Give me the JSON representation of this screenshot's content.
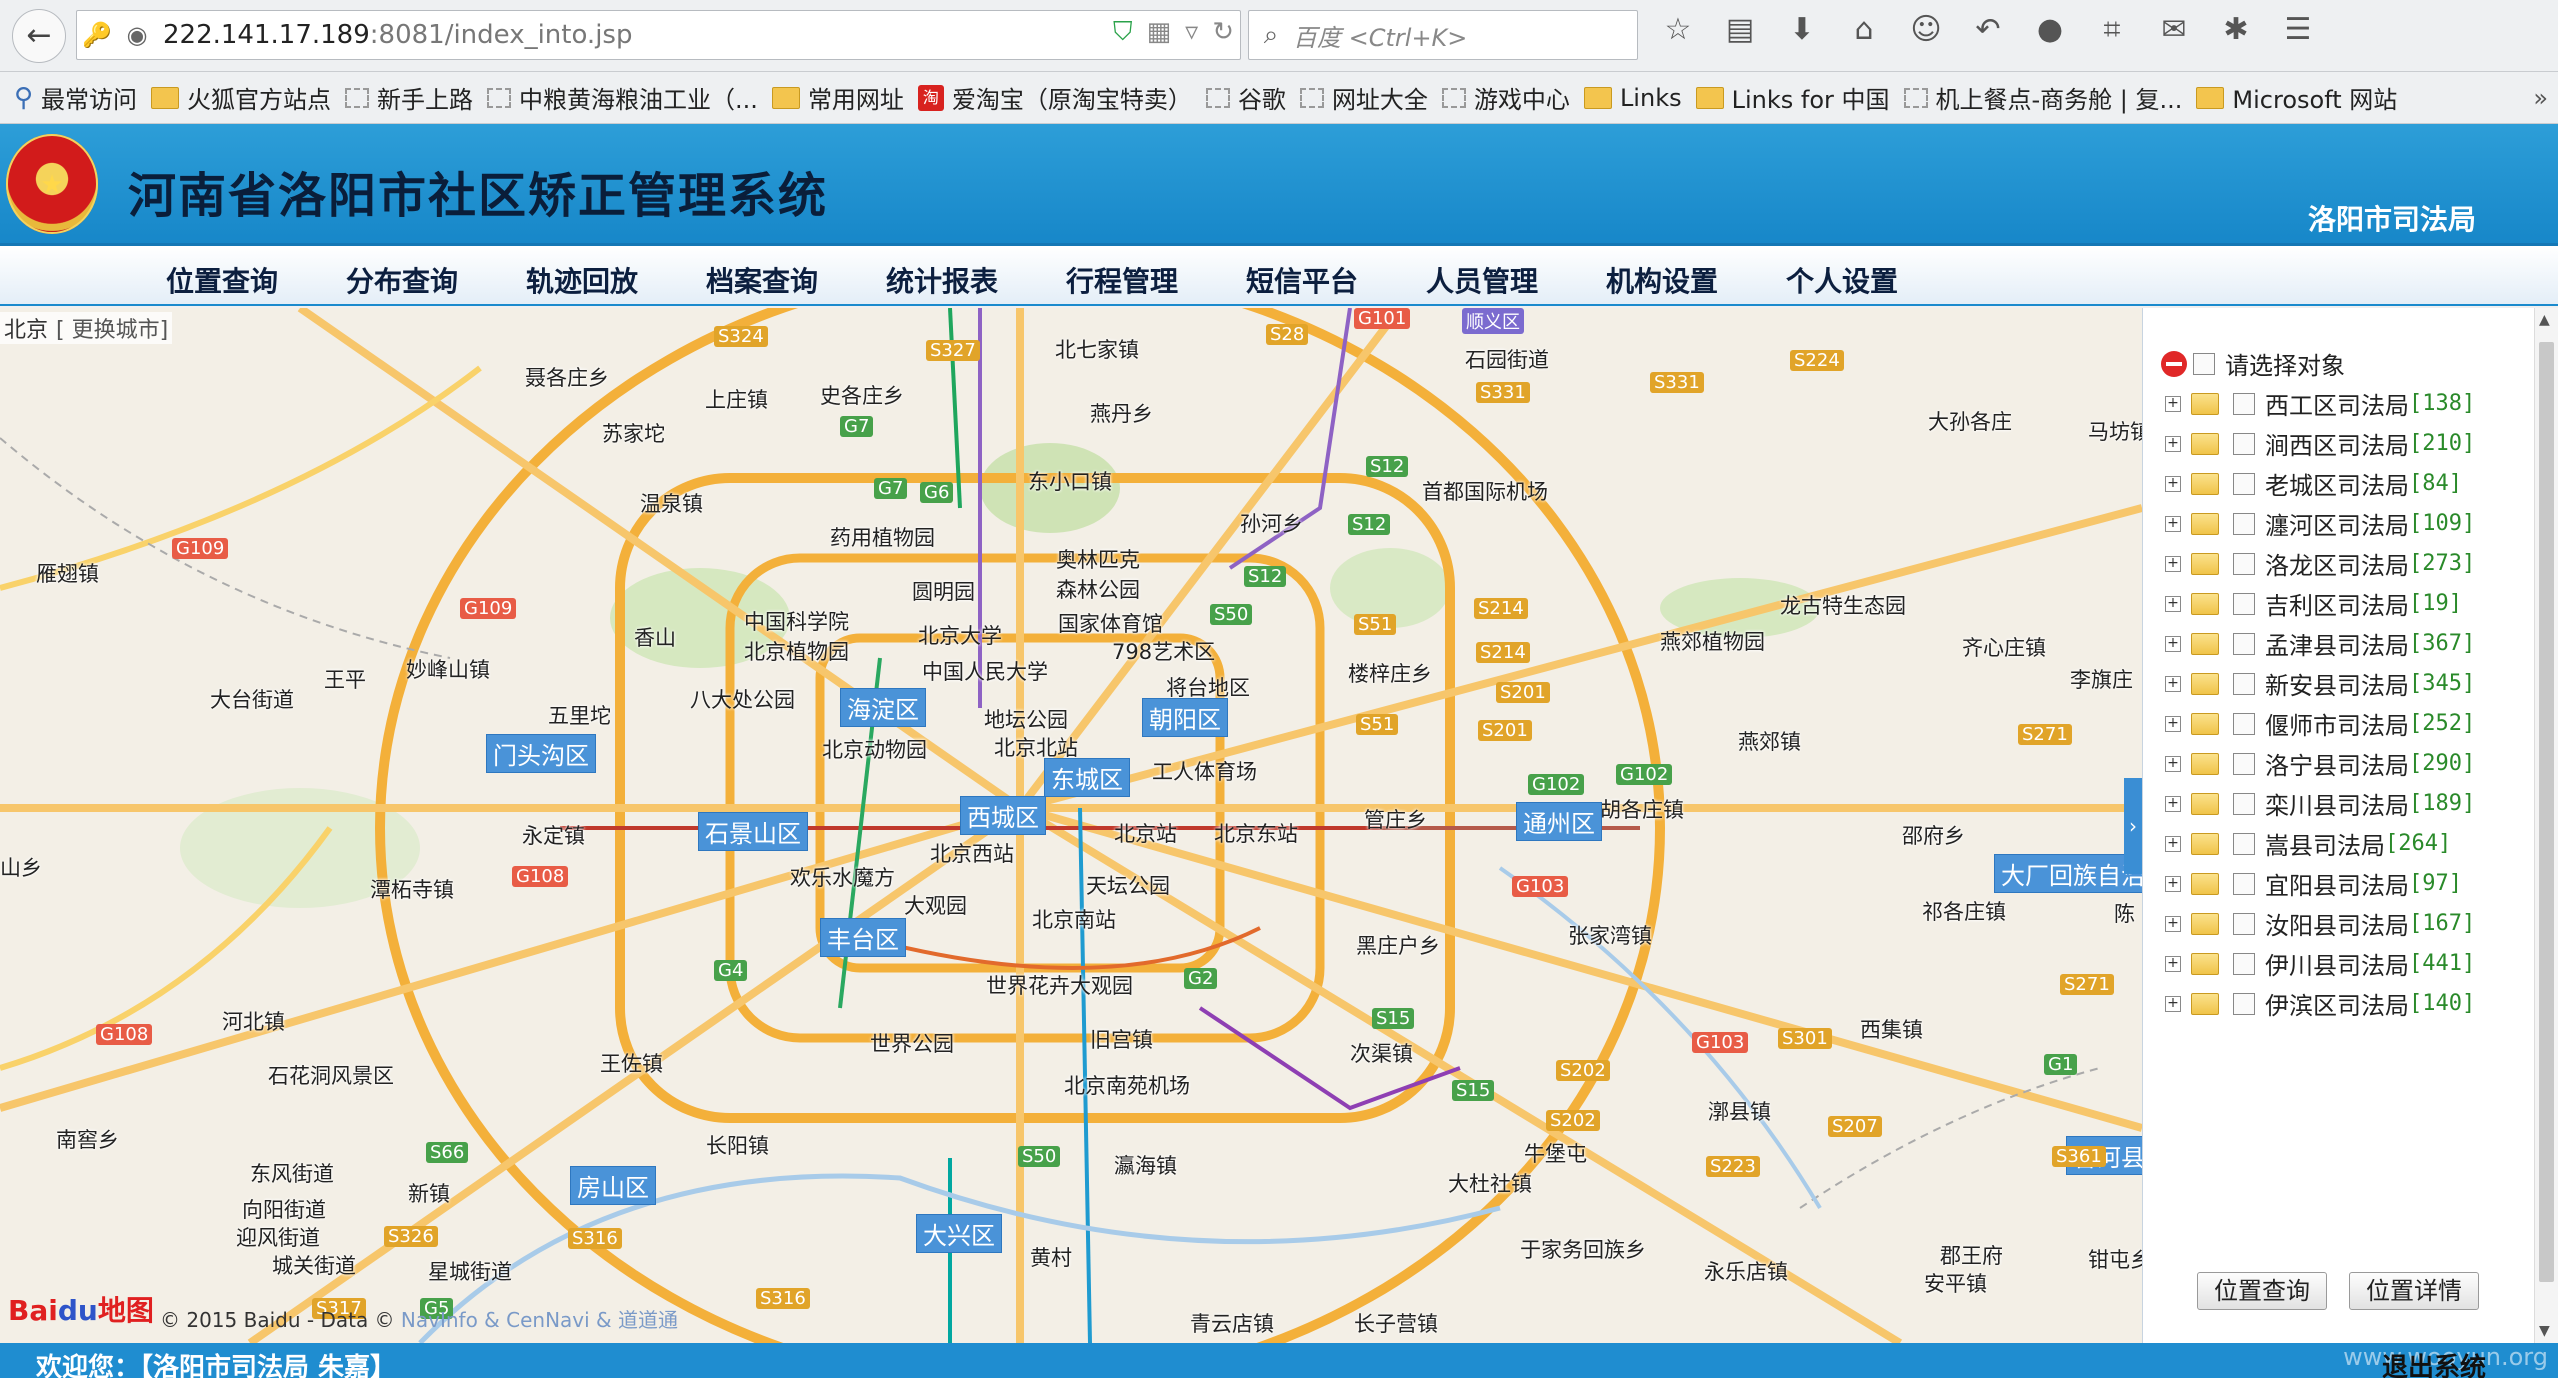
{
  "browser": {
    "back_icon": "back-arrow-icon",
    "url_host": "222.141.17.189",
    "url_rest": ":8081/index_into.jsp",
    "search_placeholder": "百度 <Ctrl+K>"
  },
  "bookmarks": [
    {
      "label": "最常访问",
      "icon": "folder"
    },
    {
      "label": "火狐官方站点",
      "icon": "folder"
    },
    {
      "label": "新手上路",
      "icon": "page"
    },
    {
      "label": "中粮黄海粮油工业（...",
      "icon": "page"
    },
    {
      "label": "常用网址",
      "icon": "folder"
    },
    {
      "label": "爱淘宝（原淘宝特卖）",
      "icon": "taobao"
    },
    {
      "label": "谷歌",
      "icon": "page"
    },
    {
      "label": "网址大全",
      "icon": "page"
    },
    {
      "label": "游戏中心",
      "icon": "page"
    },
    {
      "label": "Links",
      "icon": "folder"
    },
    {
      "label": "Links for 中国",
      "icon": "folder"
    },
    {
      "label": "机上餐点-商务舱 | 复...",
      "icon": "page"
    },
    {
      "label": "Microsoft 网站",
      "icon": "folder"
    }
  ],
  "header": {
    "title": "河南省洛阳市社区矫正管理系统",
    "org": "洛阳市司法局",
    "emblem_text": "国徽"
  },
  "menu": [
    "位置查询",
    "分布查询",
    "轨迹回放",
    "档案查询",
    "统计报表",
    "行程管理",
    "短信平台",
    "人员管理",
    "机构设置",
    "个人设置"
  ],
  "map": {
    "city": "北京",
    "change_city": "[ 更换城市]",
    "baidu_logo_a": "Bai",
    "baidu_logo_b": "du",
    "baidu_logo_c": "地图",
    "copyright": "© 2015 Baidu - Data © ",
    "copyright_providers": "NavInfo & CenNavi & 道道通",
    "labels": [
      "北七家镇",
      "聂各庄乡",
      "上庄镇",
      "史各庄乡",
      "燕丹乡",
      "石园街道",
      "苏家坨",
      "大孙各庄",
      "马坊镇",
      "温泉镇",
      "东小口镇",
      "首都国际机场",
      "药用植物园",
      "孙河乡",
      "雁翅镇",
      "奥林匹克森林公园",
      "圆明园",
      "龙古特生态园",
      "中国科学院北京植物园",
      "国家体育馆",
      "香山",
      "北京大学",
      "798艺术区",
      "燕郊植物园",
      "齐心庄镇",
      "中国人民大学",
      "楼梓庄乡",
      "李旗庄",
      "大台街道",
      "王平",
      "妙峰山镇",
      "八大处公园",
      "将台地区",
      "五里坨",
      "地坛公园",
      "北京北站",
      "燕郊镇",
      "北京动物园",
      "工人体育场",
      "永定镇",
      "北京站",
      "北京东站",
      "管庄乡",
      "胡各庄镇",
      "北京西站",
      "邵府乡",
      "欢乐水魔方",
      "天坛公园",
      "潭柘寺镇",
      "大观园",
      "祁各庄镇",
      "北京南站",
      "黑庄户乡",
      "张家湾镇",
      "世界花卉大观园",
      "河北镇",
      "旧宫镇",
      "西集镇",
      "石花洞风景区",
      "世界公园",
      "次渠镇",
      "王佐镇",
      "北京南苑机场",
      "漷县镇",
      "南窖乡",
      "长阳镇",
      "东风街道",
      "新镇",
      "瀛海镇",
      "大杜社镇",
      "牛堡屯",
      "向阳街道",
      "迎风街道",
      "城关街道",
      "黄村",
      "于家务回族乡",
      "郡王府",
      "钳屯乡",
      "星城街道",
      "永乐店镇",
      "安平镇",
      "青云店镇",
      "长子营镇",
      "山乡",
      "陈"
    ],
    "districts": [
      "海淀区",
      "朝阳区",
      "门头沟区",
      "东城区",
      "西城区",
      "石景山区",
      "通州区",
      "丰台区",
      "房山区",
      "大兴区",
      "大厂回族自治",
      "香河县"
    ],
    "highways": [
      "S324",
      "S327",
      "S28",
      "G101",
      "顺义区",
      "S224",
      "S331",
      "S331",
      "G7",
      "G7",
      "G6",
      "S12",
      "S12",
      "G109",
      "S12",
      "S50",
      "G109",
      "S214",
      "S51",
      "S214",
      "S201",
      "S51",
      "S201",
      "G102",
      "G102",
      "S271",
      "G108",
      "G103",
      "G4",
      "G2",
      "S15",
      "G108",
      "G103",
      "S301",
      "S202",
      "G1",
      "S271",
      "S15",
      "S202",
      "S207",
      "S66",
      "S50",
      "S223",
      "S361",
      "S326",
      "S316",
      "S316",
      "S317",
      "G5"
    ]
  },
  "panel": {
    "root_label": "请选择对象",
    "items": [
      {
        "name": "西工区司法局",
        "count": "[138]"
      },
      {
        "name": "涧西区司法局",
        "count": "[210]"
      },
      {
        "name": "老城区司法局",
        "count": "[84]"
      },
      {
        "name": "瀍河区司法局",
        "count": "[109]"
      },
      {
        "name": "洛龙区司法局",
        "count": "[273]"
      },
      {
        "name": "吉利区司法局",
        "count": "[19]"
      },
      {
        "name": "孟津县司法局",
        "count": "[367]"
      },
      {
        "name": "新安县司法局",
        "count": "[345]"
      },
      {
        "name": "偃师市司法局",
        "count": "[252]"
      },
      {
        "name": "洛宁县司法局",
        "count": "[290]"
      },
      {
        "name": "栾川县司法局",
        "count": "[189]"
      },
      {
        "name": "嵩县司法局",
        "count": "[264]"
      },
      {
        "name": "宜阳县司法局",
        "count": "[97]"
      },
      {
        "name": "汝阳县司法局",
        "count": "[167]"
      },
      {
        "name": "伊川县司法局",
        "count": "[441]"
      },
      {
        "name": "伊滨区司法局",
        "count": "[140]"
      }
    ],
    "btn_locate": "位置查询",
    "btn_detail": "位置详情"
  },
  "footer": {
    "welcome": "欢迎您：【洛阳市司法局 朱嘉】",
    "logout": "退出系统",
    "watermark": "www.wooyun.org"
  }
}
